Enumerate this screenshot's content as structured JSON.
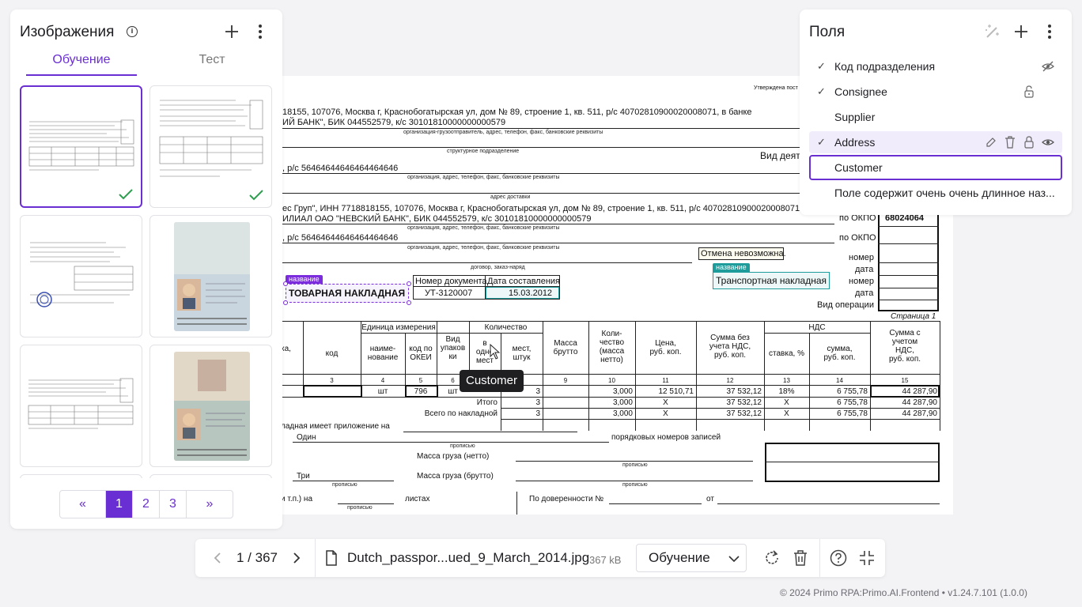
{
  "left_panel": {
    "title": "Изображения",
    "tabs": [
      {
        "label": "Обучение",
        "active": true
      },
      {
        "label": "Тест",
        "active": false
      }
    ],
    "pagination": {
      "prev": "«",
      "pages": [
        "1",
        "2",
        "3"
      ],
      "current": "1",
      "next": "»"
    }
  },
  "fields_panel": {
    "title": "Поля",
    "fields": [
      {
        "label": "Код подразделения",
        "checked": true
      },
      {
        "label": "Consignee",
        "checked": true
      },
      {
        "label": "Supplier",
        "checked": false
      },
      {
        "label": "Address",
        "checked": true
      },
      {
        "label": "Customer",
        "checked": false
      },
      {
        "label": "Поле содержит очень очень длинное наз...",
        "checked": false
      }
    ]
  },
  "toolbar": {
    "counter": "1 / 367",
    "filename": "Dutch_passpor...ued_9_March_2014.jpg",
    "filesize": "367 kB",
    "dataset": "Обучение"
  },
  "tooltip": "Customer",
  "footer": "© 2024 Primo RPA:Primo.AI.Frontend • v1.24.7.101 (1.0.0)",
  "document": {
    "approved": "Утверждена пост",
    "line1": "18155, 107076, Москва г, Краснобогатырская ул, дом № 89, строение 1, кв. 511, р/с 40702810900020008071, в банке",
    "line2": "ИЙ БАНК\", БИК 044552579, к/с 30101810000000000579",
    "cap1": "организация-грузоотправитель, адрес, телефон, факс, банковские реквизиты",
    "cap2": "структурное подразделение",
    "vid_deyat": "Вид деяте",
    "line3": ", р/с 56464644646464464646",
    "cap3": "организация, адрес, телефон, факс, банковские реквизиты",
    "cap4": "адрес доставки",
    "line4": "ес Груп\", ИНН 7718818155, 107076, Москва г, Краснобогатырская ул, дом № 89, строение 1, кв. 511, р/с 40702810900020008071, в банк",
    "line5": "ИЛИАЛ ОАО \"НЕВСКИЙ БАНК\", БИК 044552579, к/с 30101810000000000579",
    "okpo_label": "по ОКПО",
    "okpo_value": "68024064",
    "cap5": "организация, адрес, телефон, факс, банковские реквизиты",
    "line6": ", р/с 56464644646464464646",
    "okpo_label2": "по ОКПО",
    "cap6": "организация, адрес, телефон, факс, банковские реквизиты",
    "cancel_note": "Отмена невозможна.",
    "cap7": "договор, заказ-наряд",
    "nomer": "номер",
    "data": "дата",
    "nomer2": "номер",
    "data2": "дата",
    "vid_oper": "Вид операции",
    "tag_name": "название",
    "tag_name2": "название",
    "title_doc": "ТОВАРНАЯ НАКЛАДНАЯ",
    "doc_num_h": "Номер документа",
    "doc_date_h": "Дата составления",
    "doc_num": "УТ-3120007",
    "doc_date": "15.03.2012",
    "transport": "Транспортная накладная",
    "page": "Страница 1",
    "th_unit": "Единица измерения",
    "th_qty": "Количество",
    "th_nds": "НДС",
    "th_ka": "ка,",
    "th_kod": "код",
    "th_naim": "наиме-\nнование",
    "th_okei": "код по\nОКЕИ",
    "th_vid": "Вид\nупаков\nки",
    "th_v1": "в\nодно\nмест",
    "th_mest": "мест,\nштук",
    "th_mass": "Масса\nбрутто",
    "th_kol": "Коли-\nчество\n(масса\nнетто)",
    "th_price": "Цена,\nруб. коп.",
    "th_sumbez": "Сумма без\nучета НДС,\nруб. коп.",
    "th_stavka": "ставка, %",
    "th_summa": "сумма,\nруб. коп.",
    "th_sumnds": "Сумма с\nучетом\nНДС,\nруб. коп.",
    "n3": "3",
    "n4": "4",
    "n5": "5",
    "n6": "6",
    "n9": "9",
    "n10": "10",
    "n11": "11",
    "n12": "12",
    "n13": "13",
    "n14": "14",
    "n15": "15",
    "r_sht": "шт",
    "r_796": "796",
    "r_sht2": "шт",
    "r_3a": "3",
    "r_3b": "3",
    "r_3c": "3",
    "r_kol": "3,000",
    "r_kol2": "3,000",
    "r_kol3": "3,000",
    "r_price": "12 510,71",
    "r_x1": "X",
    "r_x2": "X",
    "r_sum": "37 532,12",
    "r_sum2": "37 532,12",
    "r_sum3": "37 532,12",
    "r_st": "18%",
    "r_x3": "X",
    "r_x4": "X",
    "r_nds": "6 755,78",
    "r_nds2": "6 755,78",
    "r_nds3": "6 755,78",
    "r_tot": "44 287,90",
    "r_tot2": "44 287,90",
    "r_tot3": "44 287,90",
    "itogo": "Итого",
    "vsego": "Всего по накладной",
    "prilozh": "ладная имеет приложение на",
    "odin": "Один",
    "propisyu": "прописью",
    "poryad": "порядковых номеров записей",
    "massa_netto": "Масса груза (нетто)",
    "propisyu2": "прописью",
    "tri": "Три",
    "propisyu3": "прописью",
    "massa_brutto": "Масса груза (брутто)",
    "propisyu4": "прописью",
    "itp": "и т.п.) на",
    "listah": "листах",
    "po_dov": "По доверенности №",
    "ot": "от",
    "propisyu5": "прописью"
  }
}
